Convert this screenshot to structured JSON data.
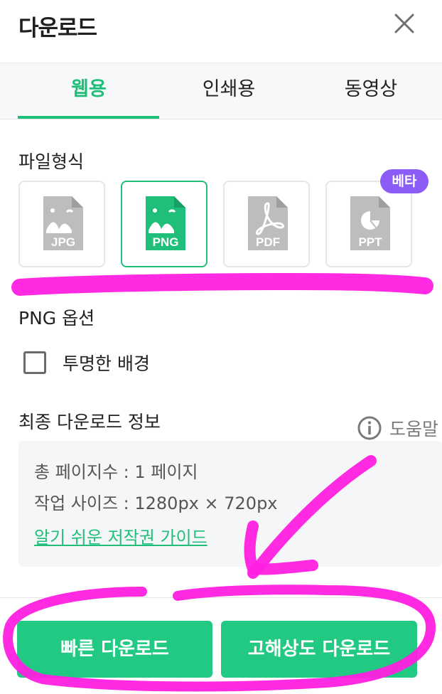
{
  "header": {
    "title": "다운로드"
  },
  "tabs": [
    {
      "label": "웹용",
      "active": true
    },
    {
      "label": "인쇄용"
    },
    {
      "label": "동영상"
    }
  ],
  "file_format": {
    "label": "파일형식",
    "options": [
      {
        "label": "JPG",
        "selected": false
      },
      {
        "label": "PNG",
        "selected": true
      },
      {
        "label": "PDF",
        "selected": false
      },
      {
        "label": "PPT",
        "selected": false,
        "badge": "베타"
      }
    ]
  },
  "png_options": {
    "label": "PNG 옵션",
    "transparent_bg_label": "투명한 배경",
    "transparent_bg_checked": false
  },
  "final_info": {
    "label": "최종 다운로드 정보",
    "help_label": "도움말",
    "pages": "총 페이지수 : 1 페이지",
    "size": "작업 사이즈 : 1280px × 720px",
    "copyright_link": "알기 쉬운 저작권 가이드"
  },
  "buttons": {
    "fast_download": "빠른 다운로드",
    "hires_download": "고해상도 다운로드"
  },
  "colors": {
    "accent": "#1fbf7a",
    "button": "#22c983",
    "beta": "#8b5cf6",
    "annotation": "#ff1fe0"
  }
}
